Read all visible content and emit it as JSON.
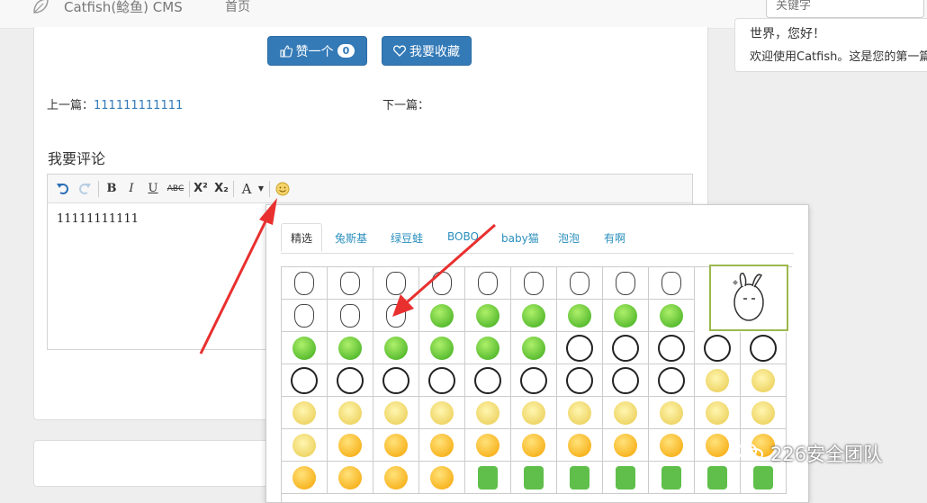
{
  "navbar": {
    "brand": "Catfish(鲶鱼) CMS",
    "home": "首页",
    "search_placeholder": "关键字"
  },
  "article": {
    "like_label": "赞一个",
    "like_count": "0",
    "favorite_label": "我要收藏",
    "prev_label": "上一篇：",
    "prev_title": "111111111111",
    "next_label": "下一篇："
  },
  "comment": {
    "heading": "我要评论",
    "toolbar": {
      "bold": "B",
      "italic": "I",
      "underline": "U",
      "strike": "ABC",
      "superscript": "X²",
      "subscript": "X₂",
      "font_color": "A"
    },
    "content": "11111111111"
  },
  "emoji_panel": {
    "tabs": [
      "精选",
      "兔斯基",
      "绿豆蛙",
      "BOBO",
      "baby猫",
      "泡泡",
      "有啊"
    ],
    "active_tab": "精选",
    "rows": [
      [
        "rabbit",
        "rabbit",
        "rabbit",
        "rabbit",
        "rabbit",
        "rabbit",
        "rabbit",
        "rabbit",
        "rabbit",
        "rabbit",
        "rabbit"
      ],
      [
        "rabbit",
        "rabbit",
        "rabbit",
        "frog",
        "frog",
        "frog",
        "frog",
        "frog",
        "frog",
        "frog",
        "frog"
      ],
      [
        "frog",
        "frog",
        "frog",
        "frog",
        "frog",
        "frog",
        "panda",
        "panda",
        "panda",
        "panda",
        "panda"
      ],
      [
        "panda",
        "panda",
        "panda",
        "panda",
        "panda",
        "panda",
        "panda",
        "panda",
        "panda",
        "cat",
        "cat"
      ],
      [
        "cat",
        "cat",
        "cat",
        "cat",
        "cat",
        "cat",
        "cat",
        "cat",
        "cat",
        "cat",
        "cat"
      ],
      [
        "cat",
        "smile",
        "smile",
        "smile",
        "smile",
        "smile",
        "smile",
        "smile",
        "smile",
        "smile",
        "smile"
      ],
      [
        "smile",
        "smile",
        "smile",
        "smile",
        "bag",
        "bag",
        "bag",
        "bag",
        "bag",
        "bag",
        "bag"
      ]
    ]
  },
  "sidebar": {
    "title": "世界，您好！",
    "text": "欢迎使用Catfish。这是您的第一篇文章"
  },
  "watermark": "226安全团队",
  "colors": {
    "primary": "#337ab7",
    "arrow": "#e8302f",
    "link": "#2a8fbd"
  }
}
